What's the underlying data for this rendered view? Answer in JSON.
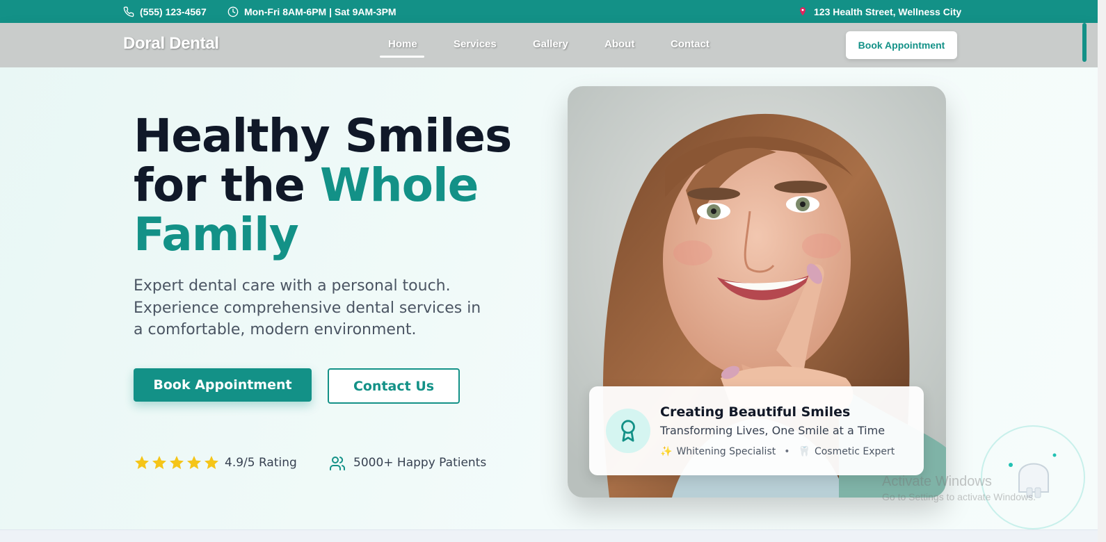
{
  "topbar": {
    "phone": "(555) 123-4567",
    "hours": "Mon-Fri 8AM-6PM | Sat 9AM-3PM",
    "address": "123 Health Street, Wellness City"
  },
  "nav": {
    "logo": "Doral Dental",
    "links": [
      "Home",
      "Services",
      "Gallery",
      "About",
      "Contact"
    ],
    "active": "Home",
    "cta": "Book Appointment"
  },
  "hero": {
    "headline_part1": "Healthy Smiles",
    "headline_part2": "for the",
    "headline_accent": "Whole Family",
    "subtitle": "Expert dental care with a personal touch. Experience comprehensive dental services in a comfortable, modern environment.",
    "primary_button": "Book Appointment",
    "secondary_button": "Contact Us",
    "rating_stars": 5,
    "rating_text": "4.9/5 Rating",
    "patients_text": "5000+ Happy Patients"
  },
  "card": {
    "title": "Creating Beautiful Smiles",
    "subtitle": "Transforming Lives, One Smile at a Time",
    "tag1": "Whitening Specialist",
    "tag2": "Cosmetic Expert",
    "tag1_icon": "✨",
    "tag2_icon": "🦷"
  },
  "watermark": {
    "title": "Activate Windows",
    "subtitle": "Go to Settings to activate Windows."
  },
  "colors": {
    "brand": "#139187",
    "heading": "#101828",
    "star": "#f5c518"
  },
  "icons": [
    "phone-icon",
    "clock-icon",
    "location-pin-icon",
    "star-icon",
    "users-icon",
    "award-icon"
  ]
}
